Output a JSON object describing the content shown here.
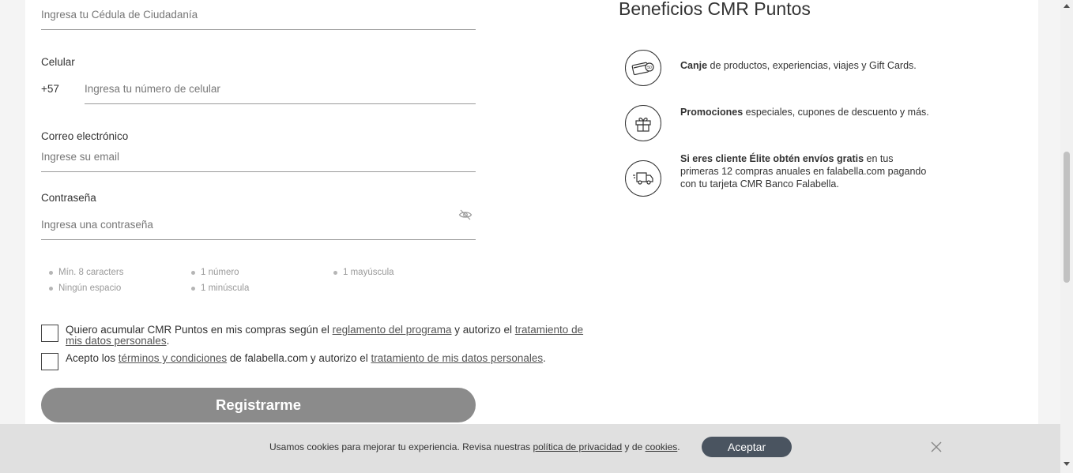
{
  "form": {
    "id_placeholder": "Ingresa tu Cédula de Ciudadanía",
    "phone_label": "Celular",
    "phone_prefix": "+57",
    "phone_placeholder": "Ingresa tu número de celular",
    "email_label": "Correo electrónico",
    "email_placeholder": "Ingrese su email",
    "password_label": "Contraseña",
    "password_placeholder": "Ingresa una contraseña",
    "password_rules": [
      "Mín. 8 caracters",
      "1 número",
      "1 mayúscula",
      "Ningún espacio",
      "1 minúscula"
    ],
    "consent1": {
      "text_a": "Quiero acumular CMR Puntos en mis compras según el ",
      "link_a": "reglamento del programa",
      "text_b": "  y autorizo el ",
      "link_b": "tratamiento de mis datos personales",
      "text_c": "."
    },
    "consent2": {
      "text_a": "Acepto los ",
      "link_a": "términos y condiciones",
      "text_b": " de falabella.com  y autorizo el ",
      "link_b": "tratamiento de mis datos personales",
      "text_c": "."
    },
    "submit_label": "Registrarme"
  },
  "benefits": {
    "title": "Beneficios CMR Puntos",
    "items": [
      {
        "icon": "card-coin-icon",
        "bold": "Canje",
        "text": " de productos, experiencias, viajes y Gift Cards."
      },
      {
        "icon": "gift-icon",
        "bold": "Promociones",
        "text": " especiales, cupones de descuento y más."
      },
      {
        "icon": "delivery-truck-icon",
        "bold": "Si eres cliente Élite obtén envíos gratis",
        "text": " en tus primeras 12 compras anuales en falabella.com pagando con tu tarjeta CMR Banco Falabella."
      }
    ]
  },
  "cookies": {
    "text_a": "Usamos cookies para mejorar tu experiencia. Revisa nuestras ",
    "link_a": "política de privacidad",
    "text_b": " y de ",
    "link_b": "cookies",
    "text_c": ".",
    "accept_label": "Aceptar"
  }
}
